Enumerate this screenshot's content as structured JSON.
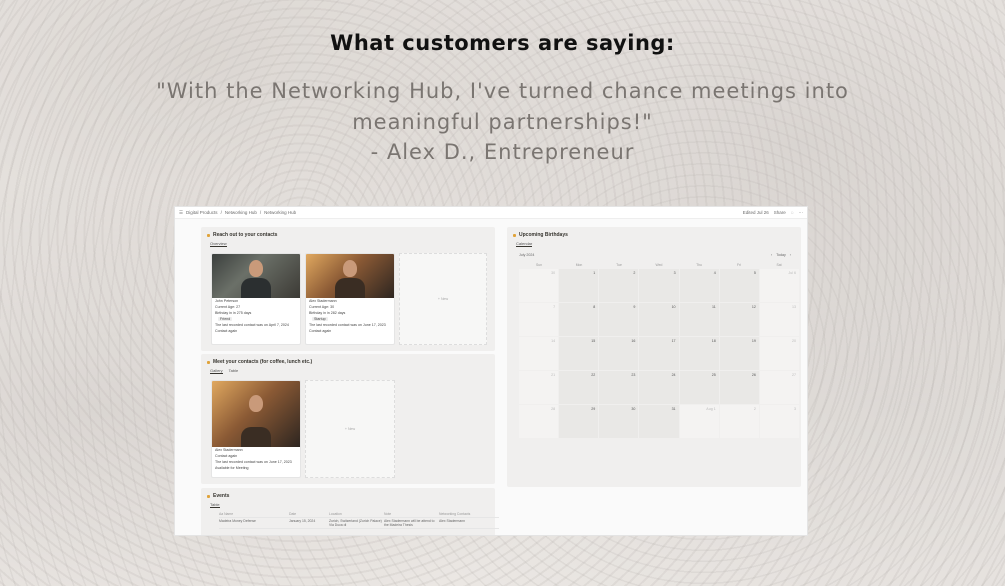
{
  "headline": "What customers are saying:",
  "quote": "\"With the Networking Hub, I've turned chance meetings into meaningful partnerships!\"",
  "author": "- Alex D., Entrepreneur",
  "app": {
    "breadcrumbs": [
      "Digital Products",
      "Networking Hub",
      "Networking Hub"
    ],
    "top_right": [
      "Edited Jul 26",
      "Share"
    ],
    "reach_out": {
      "title": "Reach out to your contacts",
      "tab": "Overview",
      "cards": [
        {
          "name": "John Peterson",
          "age": "Current Age: 27",
          "birthday": "Birthday in in 275 days",
          "tag": "Friend",
          "last": "The last recorded contact was on April 7, 2024",
          "action": "Contact again"
        },
        {
          "name": "Alex Stadermann",
          "age": "Current Age: 30",
          "birthday": "Birthday in in 282 days",
          "tag": "Startup",
          "last": "The last recorded contact was on June 17, 2023",
          "action": "Contact again"
        }
      ],
      "new_label": "+ New"
    },
    "meet": {
      "title": "Meet your contacts (for coffee, lunch etc.)",
      "tabs": [
        "Gallery",
        "Table"
      ],
      "card": {
        "name": "Alex Stadermann",
        "action": "Contact again",
        "last": "The last recorded contact was on June 17, 2023",
        "status": "Available for Meeting"
      },
      "new_label": "+ New"
    },
    "events": {
      "title": "Events",
      "tab": "Table",
      "headers": [
        "Aa Name",
        "Date",
        "Location",
        "Note",
        "Networking Contacts"
      ],
      "row": [
        "Madeira Money Defense",
        "January 15, 2024",
        "Zurich, Switzerland (Zurich Palace) Via Duca di",
        "Alex Stadermann will be attend to the Madeira Thesis",
        "Alex Stadermann"
      ]
    },
    "birthdays": {
      "title": "Upcoming Birthdays",
      "tab": "Calendar",
      "month": "July 2024",
      "today": "Today",
      "weekdays": [
        "Sun",
        "Mon",
        "Tue",
        "Wed",
        "Thu",
        "Fri",
        "Sat"
      ],
      "days": [
        "30",
        "1",
        "2",
        "3",
        "4",
        "5",
        "Jul 6",
        "7",
        "8",
        "9",
        "10",
        "11",
        "12",
        "13",
        "14",
        "15",
        "16",
        "17",
        "18",
        "19",
        "20",
        "21",
        "22",
        "23",
        "24",
        "25",
        "26",
        "27",
        "28",
        "29",
        "30",
        "31",
        "Aug 1",
        "2",
        "3"
      ]
    }
  }
}
